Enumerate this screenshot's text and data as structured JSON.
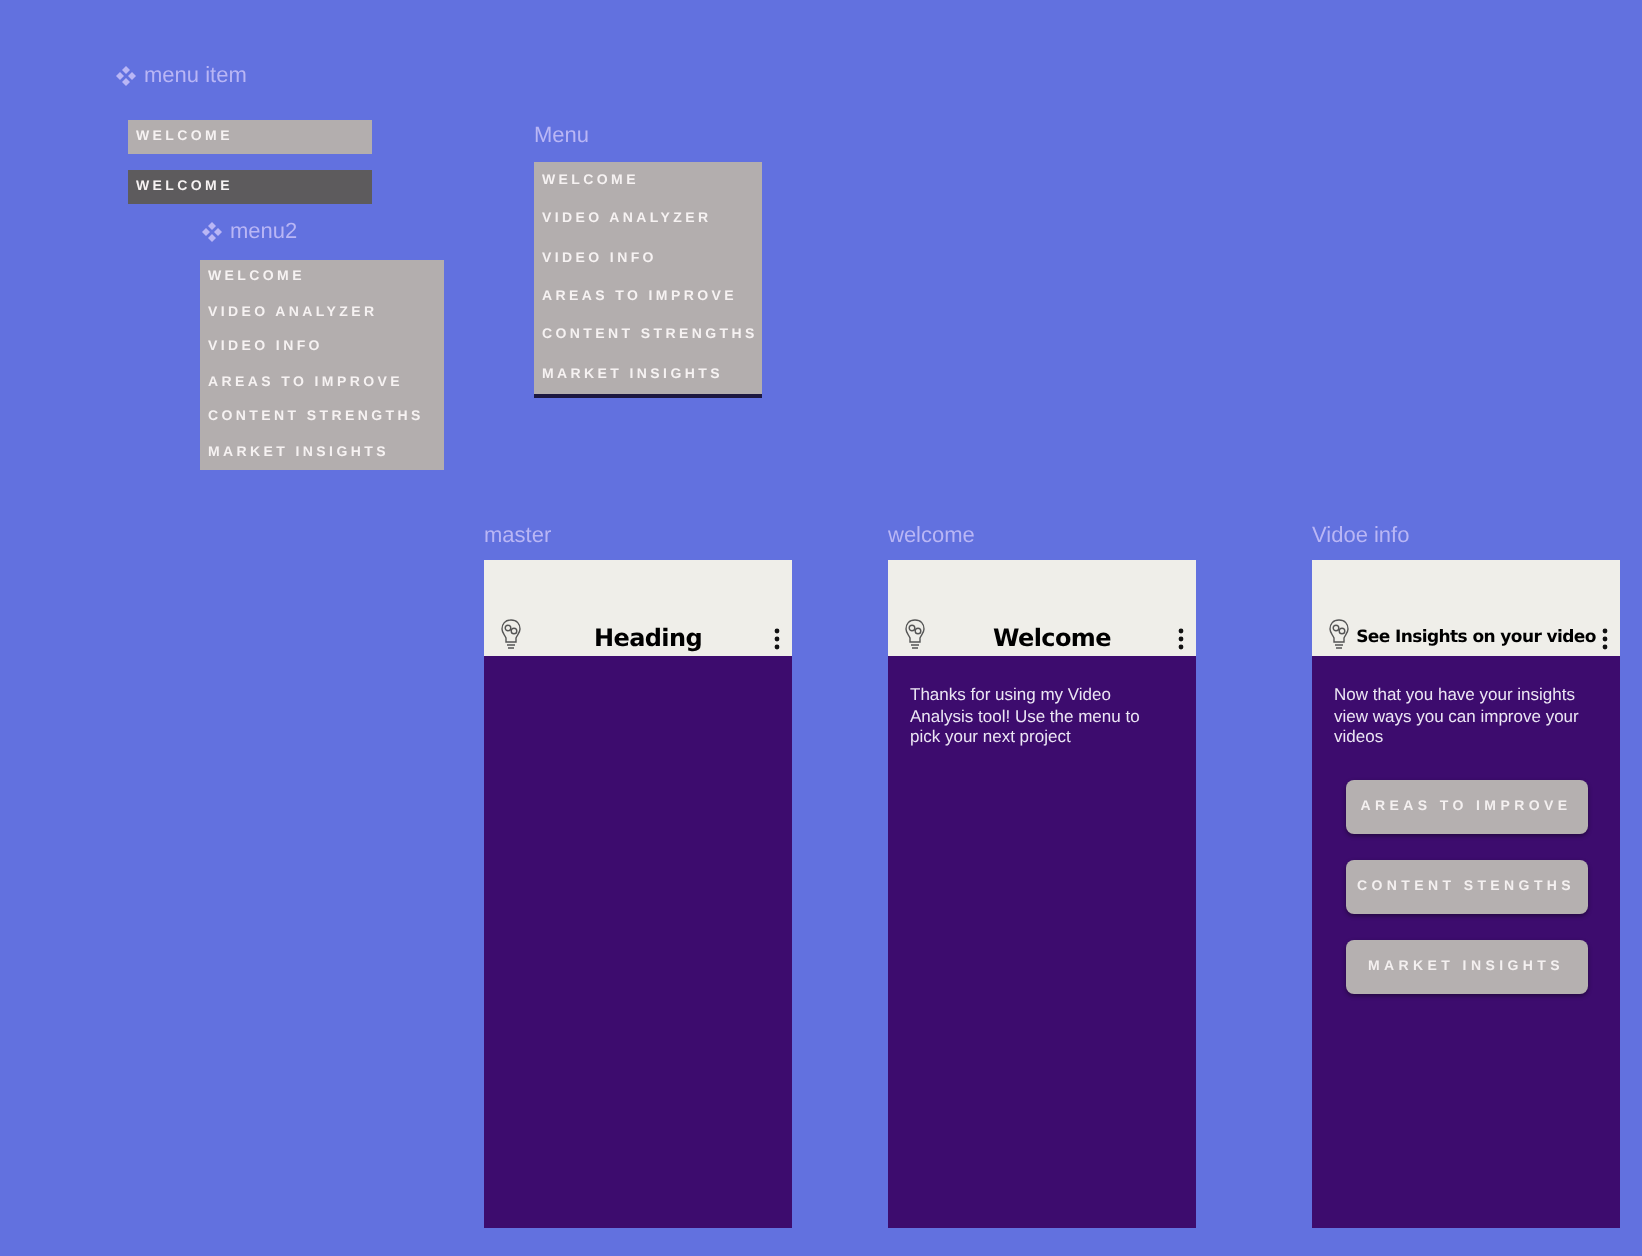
{
  "menu_item": {
    "title": "menu item",
    "component": true,
    "variants": [
      {
        "label": "WELCOME",
        "selected": false
      },
      {
        "label": "WELCOME",
        "selected": true
      }
    ]
  },
  "menu2": {
    "title": "menu2",
    "component": true,
    "items": [
      "WELCOME",
      "VIDEO ANALYZER",
      "VIDEO INFO",
      "AREAS TO IMPROVE",
      "CONTENT STRENGTHS",
      "MARKET INSIGHTS"
    ]
  },
  "menu": {
    "title": "Menu",
    "component": false,
    "items": [
      "WELCOME",
      "VIDEO ANALYZER",
      "VIDEO INFO",
      "AREAS TO IMPROVE",
      "CONTENT STRENGTHS",
      "MARKET INSIGHTS"
    ]
  },
  "frames": [
    {
      "title": "master",
      "heading": "Heading"
    },
    {
      "title": "welcome",
      "heading": "Welcome",
      "body": "Thanks for using my Video Analysis tool! Use the menu to pick your next project"
    },
    {
      "title": "Vidoe info",
      "heading": "See Insights on your video",
      "body": "Now that you have your insights view ways you can improve your videos",
      "buttons": [
        "AREAS TO IMPROVE",
        "CONTENT STENGTHS",
        "MARKET INSIGHTS"
      ]
    }
  ]
}
